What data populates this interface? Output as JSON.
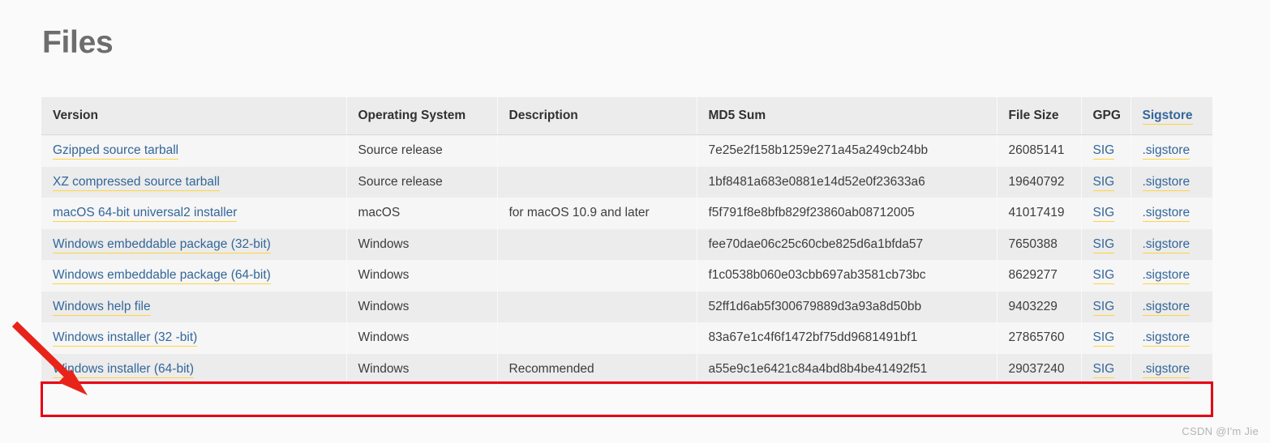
{
  "page": {
    "title": "Files",
    "watermark": "CSDN @I'm Jie"
  },
  "table": {
    "columns": [
      {
        "key": "version",
        "label": "Version",
        "is_link": false
      },
      {
        "key": "os",
        "label": "Operating System",
        "is_link": false
      },
      {
        "key": "description",
        "label": "Description",
        "is_link": false
      },
      {
        "key": "md5",
        "label": "MD5 Sum",
        "is_link": false
      },
      {
        "key": "size",
        "label": "File Size",
        "is_link": false
      },
      {
        "key": "gpg",
        "label": "GPG",
        "is_link": false
      },
      {
        "key": "sigstore",
        "label": "Sigstore",
        "is_link": true
      }
    ],
    "rows": [
      {
        "version": "Gzipped source tarball",
        "os": "Source release",
        "description": "",
        "md5": "7e25e2f158b1259e271a45a249cb24bb",
        "size": "26085141",
        "gpg": "SIG",
        "sigstore": ".sigstore"
      },
      {
        "version": "XZ compressed source tarball",
        "os": "Source release",
        "description": "",
        "md5": "1bf8481a683e0881e14d52e0f23633a6",
        "size": "19640792",
        "gpg": "SIG",
        "sigstore": ".sigstore"
      },
      {
        "version": "macOS 64-bit universal2 installer",
        "os": "macOS",
        "description": "for macOS 10.9 and later",
        "md5": "f5f791f8e8bfb829f23860ab08712005",
        "size": "41017419",
        "gpg": "SIG",
        "sigstore": ".sigstore"
      },
      {
        "version": "Windows embeddable package (32-bit)",
        "os": "Windows",
        "description": "",
        "md5": "fee70dae06c25c60cbe825d6a1bfda57",
        "size": "7650388",
        "gpg": "SIG",
        "sigstore": ".sigstore"
      },
      {
        "version": "Windows embeddable package (64-bit)",
        "os": "Windows",
        "description": "",
        "md5": "f1c0538b060e03cbb697ab3581cb73bc",
        "size": "8629277",
        "gpg": "SIG",
        "sigstore": ".sigstore"
      },
      {
        "version": "Windows help file",
        "os": "Windows",
        "description": "",
        "md5": "52ff1d6ab5f300679889d3a93a8d50bb",
        "size": "9403229",
        "gpg": "SIG",
        "sigstore": ".sigstore"
      },
      {
        "version": "Windows installer (32 -bit)",
        "os": "Windows",
        "description": "",
        "md5": "83a67e1c4f6f1472bf75dd9681491bf1",
        "size": "27865760",
        "gpg": "SIG",
        "sigstore": ".sigstore"
      },
      {
        "version": "Windows installer (64-bit)",
        "os": "Windows",
        "description": "Recommended",
        "md5": "a55e9c1e6421c84a4bd8b4be41492f51",
        "size": "29037240",
        "gpg": "SIG",
        "sigstore": ".sigstore"
      }
    ]
  },
  "annotations": {
    "highlight_color": "#e60012",
    "arrow_color": "#e8231a",
    "highlighted_row_index": 7
  },
  "colors": {
    "link": "#336699",
    "link_underline": "#ffd43b",
    "header_bg": "#ececec",
    "row_odd_bg": "#f6f6f6",
    "row_even_bg": "#ececec",
    "page_bg": "#fafafa",
    "title": "#6d6d6d"
  }
}
